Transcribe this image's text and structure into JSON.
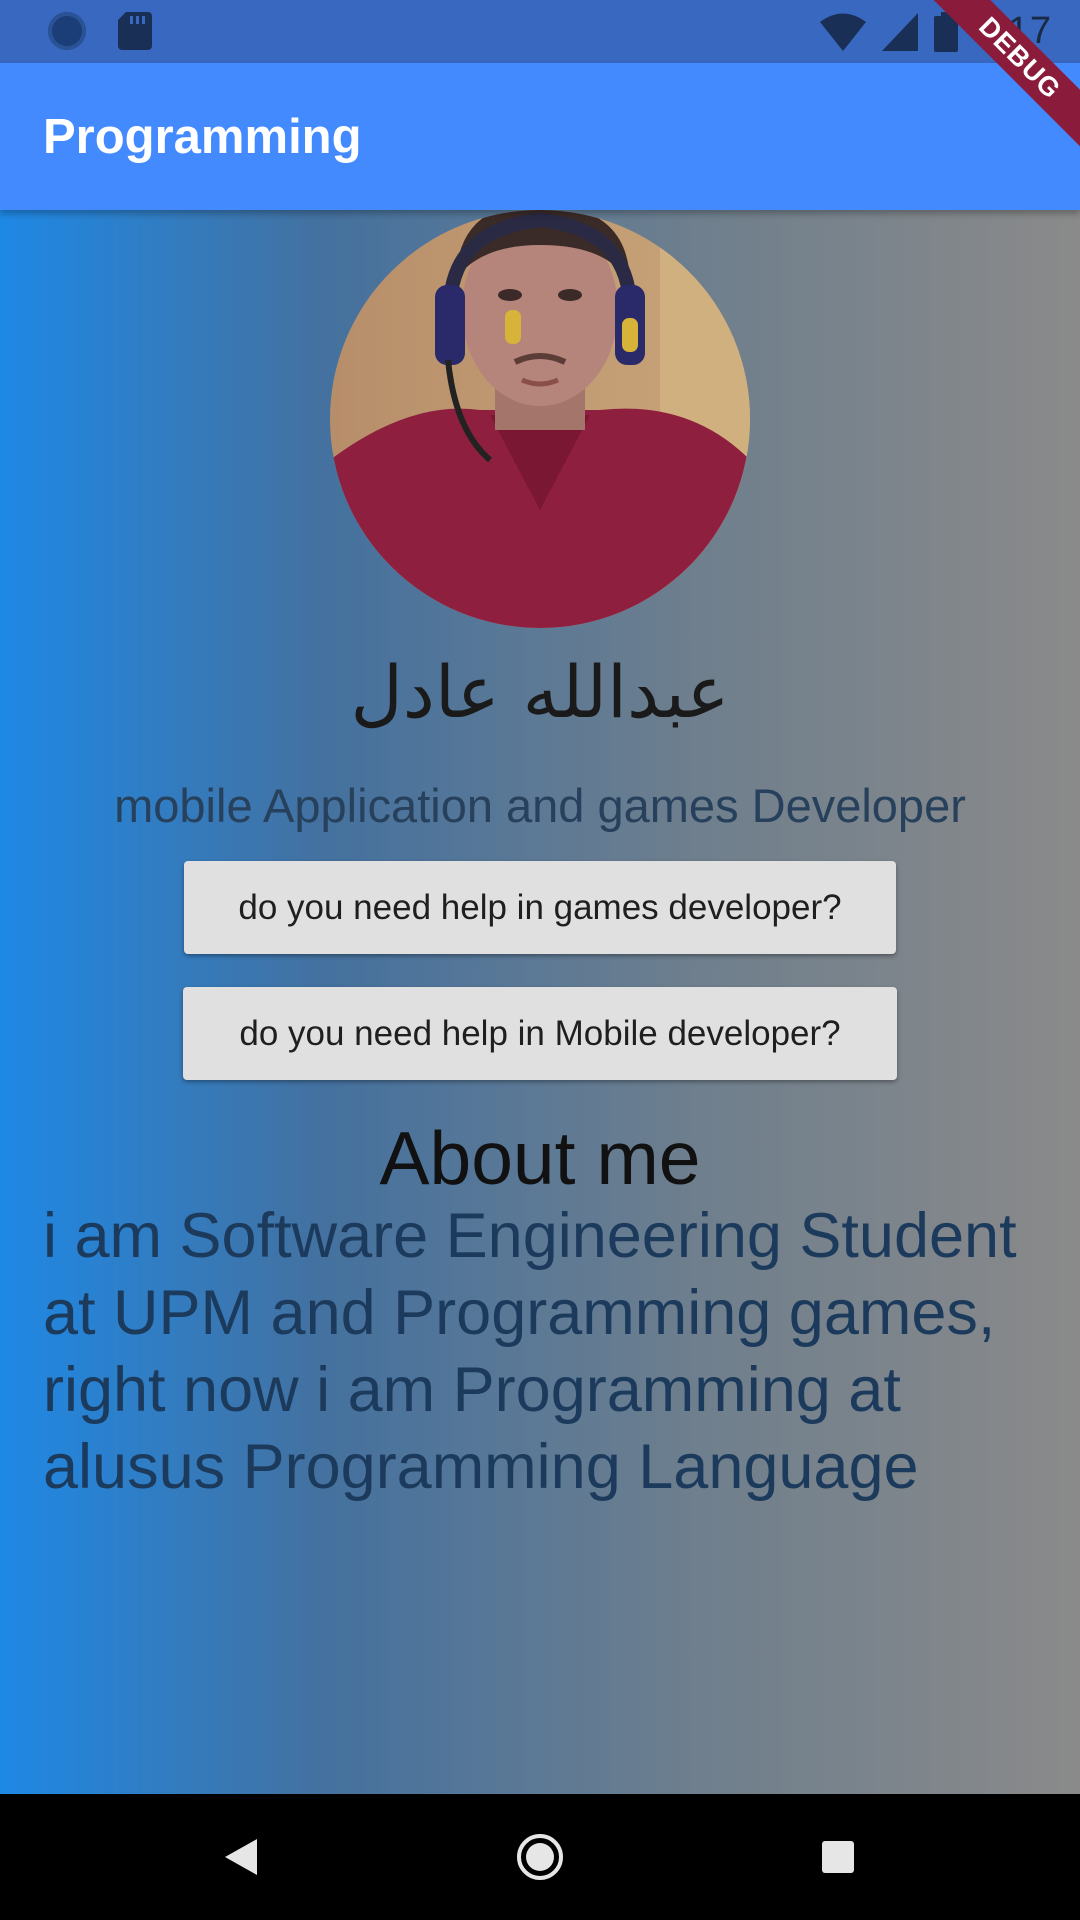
{
  "status_bar": {
    "time": "9:17",
    "icons": [
      "record-icon",
      "sd-card-icon",
      "wifi-icon",
      "signal-icon",
      "battery-icon"
    ]
  },
  "app_bar": {
    "title": "Programming",
    "debug_banner": "DEBUG"
  },
  "profile": {
    "name": "عبدالله عادل",
    "subtitle": "mobile Application and games Developer"
  },
  "buttons": {
    "games": "do you need help in games developer?",
    "mobile": "do you need help in Mobile developer?"
  },
  "about": {
    "title": "About me",
    "text": "i am Software Engineering Student at UPM and Programming games, right now i am Programming at alusus Programming Language"
  },
  "nav": {
    "icons": [
      "back-icon",
      "home-icon",
      "recents-icon"
    ]
  },
  "colors": {
    "status_bar": "#3868bf",
    "app_bar": "#448aff",
    "button_bg": "#e0e0e0",
    "gradient_start": "#1e88e5",
    "gradient_end": "#8a8a8a"
  }
}
